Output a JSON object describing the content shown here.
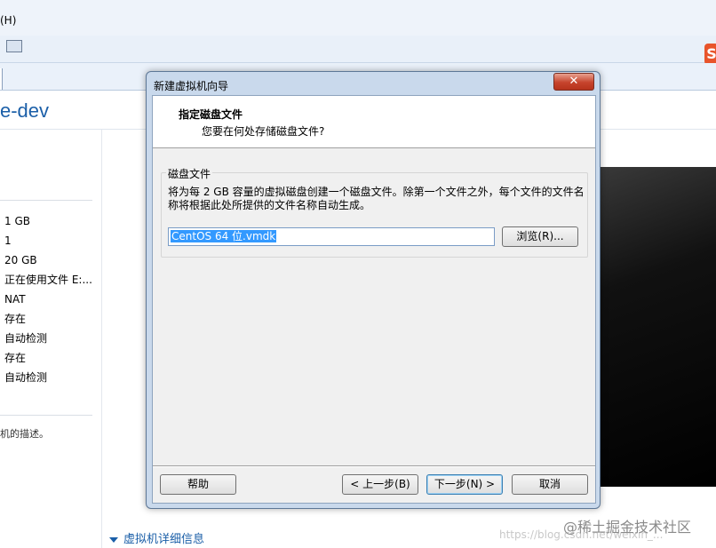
{
  "app": {
    "menu_help": "(H)",
    "vm_title": "e-dev",
    "hardware_values": [
      "1 GB",
      "1",
      "20 GB",
      "正在使用文件 E:...",
      "NAT",
      "存在",
      "自动检测",
      "存在",
      "自动检测"
    ],
    "description_hint": "机的描述。",
    "details_header": "虚拟机详细信息",
    "watermark": "https://blog.csdn.net/weixin_...",
    "brand_watermark": "@稀土掘金技术社区"
  },
  "dialog": {
    "title": "新建虚拟机向导",
    "close_label": "✕",
    "header_title": "指定磁盘文件",
    "header_subtitle": "您要在何处存储磁盘文件?",
    "group_label": "磁盘文件",
    "group_description": "将为每 2 GB 容量的虚拟磁盘创建一个磁盘文件。除第一个文件之外，每个文件的文件名称将根据此处所提供的文件名称自动生成。",
    "file_name_value": "CentOS 64 位.vmdk",
    "browse_label": "浏览(R)...",
    "help_label": "帮助",
    "back_label": "< 上一步(B)",
    "next_label": "下一步(N) >",
    "cancel_label": "取消"
  },
  "colors": {
    "accent_blue": "#1b5fa8",
    "selection": "#3399ff",
    "close_red": "#c6432c"
  }
}
